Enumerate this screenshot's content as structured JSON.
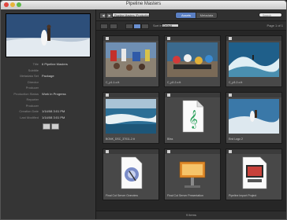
{
  "window": {
    "title": "Pipeline Masters"
  },
  "preview": {
    "description_icon": "surfer-photo"
  },
  "metadata": [
    {
      "key": "Title",
      "value": "6 Pipeline Masters"
    },
    {
      "key": "Subtitle",
      "value": ""
    },
    {
      "key": "Metadata Set",
      "value": "Package"
    },
    {
      "key": "Director",
      "value": ""
    },
    {
      "key": "Producer",
      "value": ""
    },
    {
      "key": "Production Status",
      "value": "Work in Progress"
    },
    {
      "key": "Reporter",
      "value": ""
    },
    {
      "key": "Producer",
      "value": ""
    },
    {
      "key": "Creation Date",
      "value": "1/14/08 3:01 PM"
    },
    {
      "key": "Last Modified",
      "value": "1/14/08 3:01 PM"
    }
  ],
  "toolbar": {
    "back_label": "◀",
    "forward_label": "▶",
    "location": "Pipeline Masters (Production 1)",
    "tabs": {
      "assets": "Assets",
      "metadata": "Metadata"
    },
    "search_placeholder": "Search",
    "sort_label": "Sort by",
    "sort_value": "Default",
    "page_text": "Page 1 of 1"
  },
  "assets": [
    {
      "name": "C_p1-1-c.tt",
      "kind": "photo-crowd"
    },
    {
      "name": "C_p2-2-c.tt",
      "kind": "photo-photographers"
    },
    {
      "name": "C_p3-2-c.tt",
      "kind": "photo-wave"
    },
    {
      "name": "BONK_DSC_37011-2.tt",
      "kind": "photo-aerial"
    },
    {
      "name": "Bliss",
      "kind": "audio-file"
    },
    {
      "name": "End Logo 2",
      "kind": "photo-surfer"
    },
    {
      "name": "Final Cut Server Overview",
      "kind": "pdf-doc"
    },
    {
      "name": "Final Cut Server Presentation",
      "kind": "keynote-doc"
    },
    {
      "name": "Pipeline Import Project",
      "kind": "fcp-project"
    }
  ],
  "footer": {
    "status": "9 items"
  },
  "colors": {
    "accent": "#5a7fc2",
    "window_bg": "#2b2b2b"
  }
}
